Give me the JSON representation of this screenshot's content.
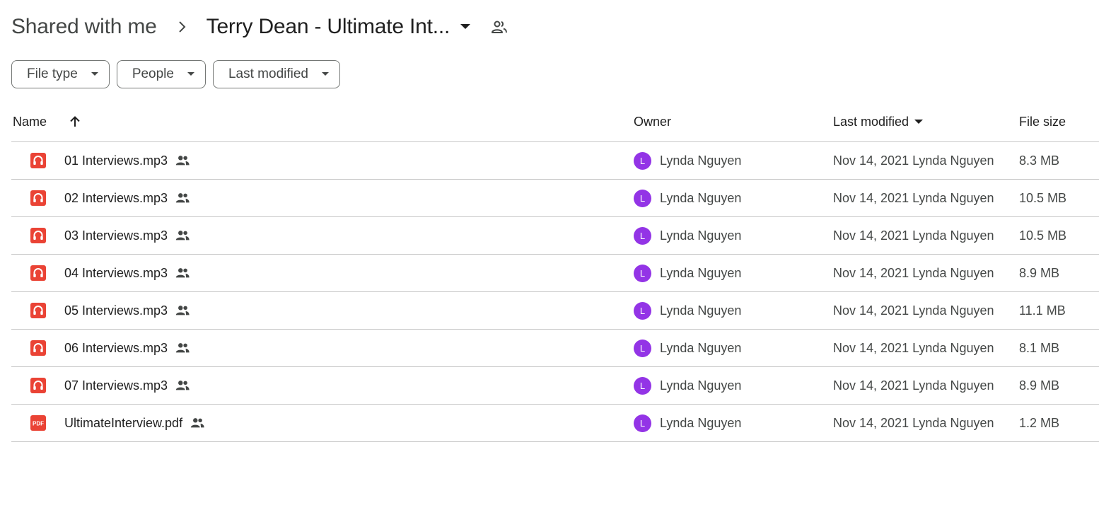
{
  "breadcrumb": {
    "root": "Shared with me",
    "current": "Terry Dean - Ultimate Int..."
  },
  "filters": [
    {
      "label": "File type"
    },
    {
      "label": "People"
    },
    {
      "label": "Last modified"
    }
  ],
  "columns": {
    "name": "Name",
    "owner": "Owner",
    "modified": "Last modified",
    "size": "File size"
  },
  "files": [
    {
      "name": "01 Interviews.mp3",
      "icon": "audio-file-icon",
      "owner": "Lynda Nguyen",
      "owner_initial": "L",
      "modified": "Nov 14, 2021 Lynda Nguyen",
      "size": "8.3 MB"
    },
    {
      "name": "02 Interviews.mp3",
      "icon": "audio-file-icon",
      "owner": "Lynda Nguyen",
      "owner_initial": "L",
      "modified": "Nov 14, 2021 Lynda Nguyen",
      "size": "10.5 MB"
    },
    {
      "name": "03 Interviews.mp3",
      "icon": "audio-file-icon",
      "owner": "Lynda Nguyen",
      "owner_initial": "L",
      "modified": "Nov 14, 2021 Lynda Nguyen",
      "size": "10.5 MB"
    },
    {
      "name": "04 Interviews.mp3",
      "icon": "audio-file-icon",
      "owner": "Lynda Nguyen",
      "owner_initial": "L",
      "modified": "Nov 14, 2021 Lynda Nguyen",
      "size": "8.9 MB"
    },
    {
      "name": "05 Interviews.mp3",
      "icon": "audio-file-icon",
      "owner": "Lynda Nguyen",
      "owner_initial": "L",
      "modified": "Nov 14, 2021 Lynda Nguyen",
      "size": "11.1 MB"
    },
    {
      "name": "06 Interviews.mp3",
      "icon": "audio-file-icon",
      "owner": "Lynda Nguyen",
      "owner_initial": "L",
      "modified": "Nov 14, 2021 Lynda Nguyen",
      "size": "8.1 MB"
    },
    {
      "name": "07 Interviews.mp3",
      "icon": "audio-file-icon",
      "owner": "Lynda Nguyen",
      "owner_initial": "L",
      "modified": "Nov 14, 2021 Lynda Nguyen",
      "size": "8.9 MB"
    },
    {
      "name": "UltimateInterview.pdf",
      "icon": "pdf-file-icon",
      "icon_text": "PDF",
      "owner": "Lynda Nguyen",
      "owner_initial": "L",
      "modified": "Nov 14, 2021 Lynda Nguyen",
      "size": "1.2 MB"
    }
  ],
  "colors": {
    "file_icon_red": "#ea4335",
    "avatar_purple": "#9334e6",
    "divider": "#c7c7c7",
    "text_primary": "#1f1f1f",
    "text_secondary": "#444746"
  }
}
